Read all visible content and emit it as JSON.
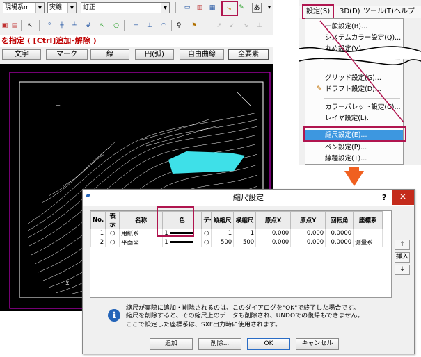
{
  "cad": {
    "combo1": "現場系m",
    "combo2": "実線",
    "combo3": "訂正",
    "prompt": "を指定 ( [Ctrl]追加･解除 )",
    "mode_buttons": [
      "文字",
      "マーク",
      "線",
      "円(弧)",
      "自由曲線",
      "全要素"
    ]
  },
  "menu": {
    "bar": [
      "設定(S)",
      "3D(D)",
      "ツール(T)",
      "ヘルプ(H)"
    ],
    "items": [
      "一般設定(B)...",
      "システムカラー設定(Q)...",
      "丸め設定(V)...",
      "グリッド設定(G)...",
      "ドラフト設定(D)...",
      "カラーパレット設定(C)...",
      "レイヤ設定(L)...",
      "縮尺設定(E)...",
      "ペン設定(P)...",
      "線種設定(T)..."
    ]
  },
  "dialog": {
    "title": "縮尺設定",
    "help": "?",
    "close": "×",
    "headers": [
      "No.",
      "表示",
      "名称",
      "色",
      "データ",
      "縦縮尺",
      "横縮尺",
      "原点X",
      "原点Y",
      "回転角",
      "座標系"
    ],
    "rows": [
      {
        "no": "1",
        "name": "用紙系",
        "color": "1",
        "data": "",
        "v": "1",
        "h": "1",
        "x": "0.000",
        "y": "0.000",
        "rot": "0.0000",
        "coord": ""
      },
      {
        "no": "2",
        "name": "平面図",
        "color": "1",
        "data": "",
        "v": "500",
        "h": "500",
        "x": "0.000",
        "y": "0.000",
        "rot": "0.0000",
        "coord": "測量系"
      }
    ],
    "side_buttons": [
      "↑",
      "挿入",
      "↓"
    ],
    "info_lines": [
      "縮尺が実際に追加・削除されるのは、このダイアログを\"OK\"で終了した場合です。",
      "縮尺を削除すると、その縮尺上のデータも削除され、UNDOでの復帰もできません。",
      "ここで設定した座標系は、SXF出力時に使用されます。"
    ],
    "buttons": [
      "追加",
      "削除...",
      "OK",
      "キャンセル"
    ]
  },
  "colors": {
    "highlight": "#b0154f",
    "arrow": "#f06020",
    "selection": "#3d97e0",
    "polygon": "#3ee0e8"
  }
}
